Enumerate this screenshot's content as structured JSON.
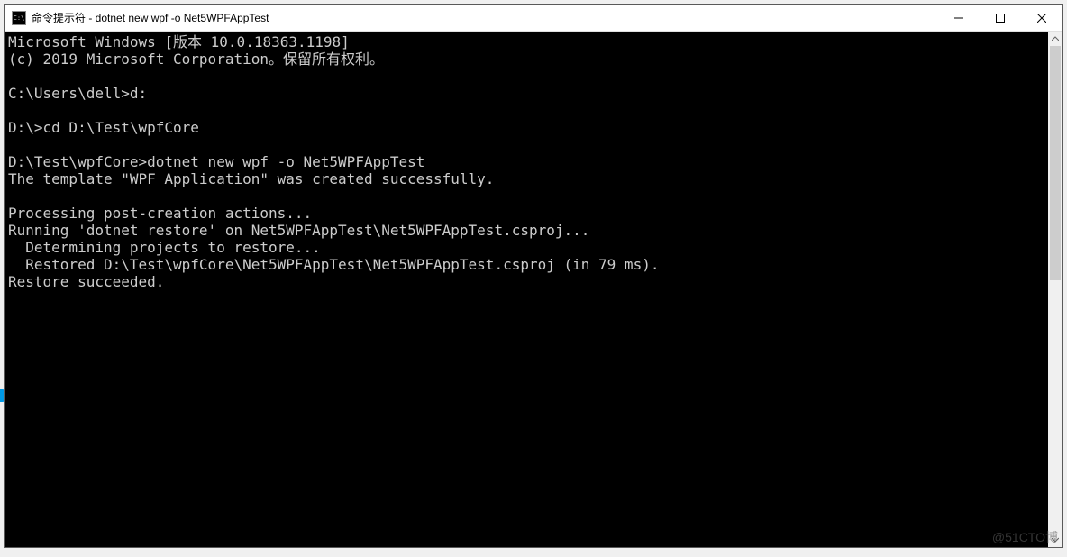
{
  "window": {
    "title": "命令提示符 - dotnet  new wpf -o Net5WPFAppTest",
    "icon_label": "C:\\"
  },
  "terminal": {
    "lines": [
      "Microsoft Windows [版本 10.0.18363.1198]",
      "(c) 2019 Microsoft Corporation。保留所有权利。",
      "",
      "C:\\Users\\dell>d:",
      "",
      "D:\\>cd D:\\Test\\wpfCore",
      "",
      "D:\\Test\\wpfCore>dotnet new wpf -o Net5WPFAppTest",
      "The template \"WPF Application\" was created successfully.",
      "",
      "Processing post-creation actions...",
      "Running 'dotnet restore' on Net5WPFAppTest\\Net5WPFAppTest.csproj...",
      "  Determining projects to restore...",
      "  Restored D:\\Test\\wpfCore\\Net5WPFAppTest\\Net5WPFAppTest.csproj (in 79 ms).",
      "Restore succeeded.",
      ""
    ]
  },
  "watermark": "@51CTO博"
}
